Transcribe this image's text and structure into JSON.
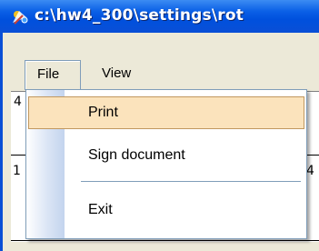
{
  "window": {
    "title": "c:\\hw4_300\\settings\\rot"
  },
  "menubar": {
    "items": [
      {
        "label": "File",
        "state": "open"
      },
      {
        "label": "View"
      }
    ]
  },
  "file_menu": {
    "items": [
      {
        "label": "Print",
        "highlighted": true
      },
      {
        "label": "Sign document"
      },
      {
        "type": "separator"
      },
      {
        "label": "Exit"
      }
    ]
  },
  "background": {
    "fragment_a": "4",
    "fragment_b": "1",
    "fragment_c": "4"
  },
  "colors": {
    "titlebar": "#0a5fe6",
    "highlight_fill": "#fbe3bc",
    "highlight_border": "#c1985f"
  }
}
